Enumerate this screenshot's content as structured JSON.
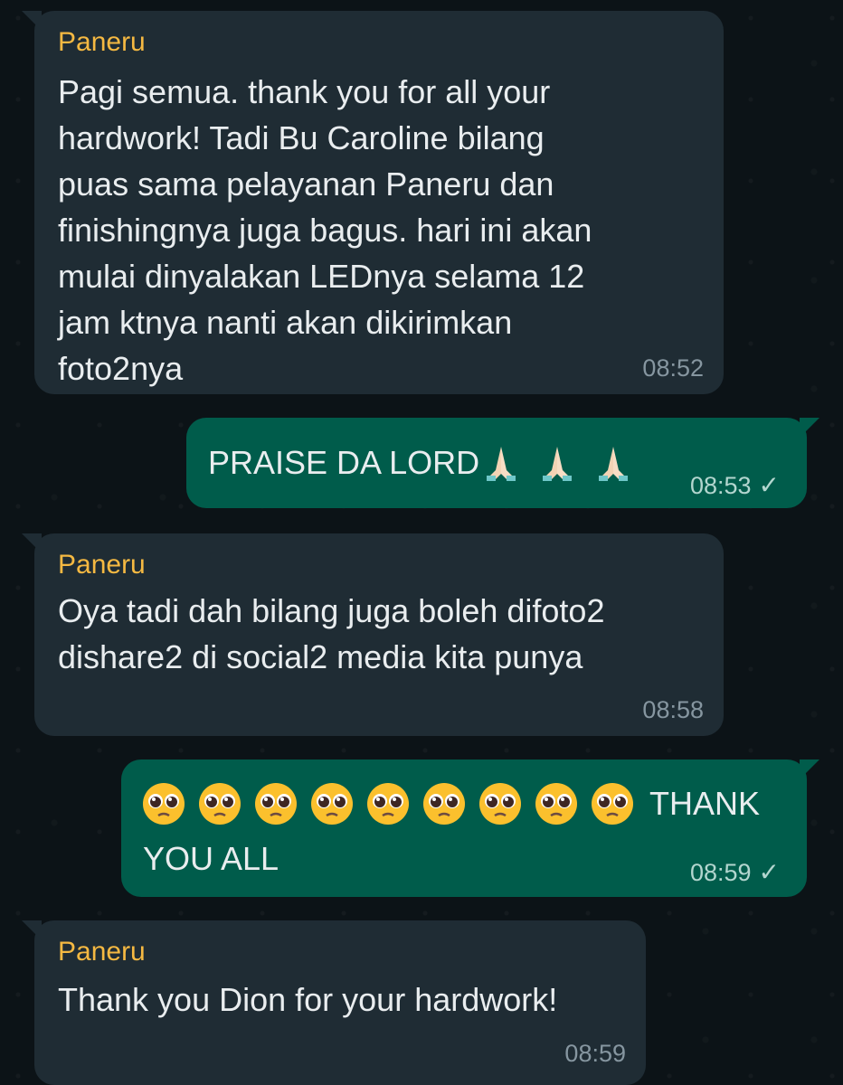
{
  "messages": [
    {
      "direction": "incoming",
      "sender": "Paneru",
      "text": "Pagi semua. thank you for all your\nhardwork! Tadi Bu Caroline bilang\npuas sama pelayanan Paneru dan\nfinishingnya juga bagus. hari ini akan\nmulai dinyalakan LEDnya selama 12\njam ktnya nanti akan dikirimkan\nfoto2nya",
      "time": "08:52"
    },
    {
      "direction": "outgoing",
      "text": "PRAISE DA LORD",
      "emojis": [
        "pray-icon",
        "pray-icon",
        "pray-icon"
      ],
      "time": "08:53",
      "status": "sent"
    },
    {
      "direction": "incoming",
      "sender": "Paneru",
      "text": "Oya tadi dah bilang juga boleh difoto2\ndishare2 di social2 media kita punya",
      "time": "08:58"
    },
    {
      "direction": "outgoing",
      "emojis": [
        "pleading-face-icon",
        "pleading-face-icon",
        "pleading-face-icon",
        "pleading-face-icon",
        "pleading-face-icon",
        "pleading-face-icon",
        "pleading-face-icon",
        "pleading-face-icon",
        "pleading-face-icon"
      ],
      "text_line1": "THANK",
      "text_line2": "YOU ALL",
      "time": "08:59",
      "status": "sent"
    },
    {
      "direction": "incoming",
      "sender": "Paneru",
      "text": "Thank you Dion for your hardwork!",
      "time": "08:59"
    }
  ],
  "icons": {
    "check": "✓"
  },
  "colors": {
    "incoming_bubble": "#1f2c34",
    "outgoing_bubble": "#005c4b",
    "sender_name": "#f5b942",
    "timestamp": "#8696a0"
  }
}
